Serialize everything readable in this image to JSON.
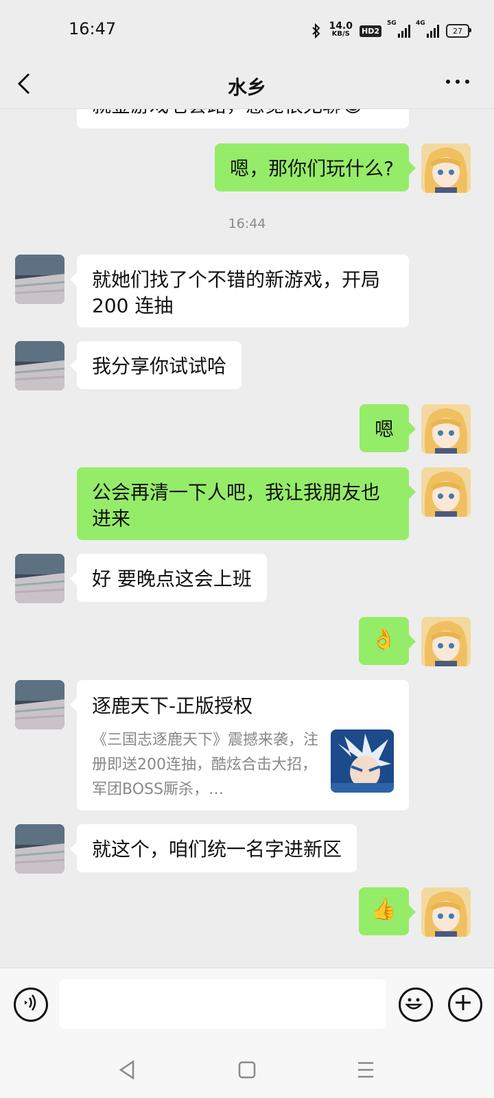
{
  "status_bar": {
    "time": "16:47",
    "net_speed_value": "14.0",
    "net_speed_unit": "KB/S",
    "hd_badge": "HD2",
    "signal1_label": "5G",
    "signal2_label": "4G",
    "battery": "27"
  },
  "nav": {
    "title": "水乡",
    "back_icon": "chevron-left-icon",
    "more_icon": "more-dots-icon"
  },
  "messages": [
    {
      "side": "in",
      "text": "就金游戏老套路，感觉很无聊😂"
    },
    {
      "side": "out",
      "text": "嗯，那你们玩什么?"
    },
    {
      "side": "time",
      "text": "16:44"
    },
    {
      "side": "in",
      "text": "就她们找了个不错的新游戏，开局200 连抽"
    },
    {
      "side": "in",
      "text": "我分享你试试哈"
    },
    {
      "side": "out",
      "text": "嗯"
    },
    {
      "side": "out",
      "text": "公会再清一下人吧，我让我朋友也进来"
    },
    {
      "side": "in",
      "text": "好 要晚点这会上班"
    },
    {
      "side": "out",
      "text": "👌"
    },
    {
      "side": "in",
      "type": "card",
      "title": "逐鹿天下-正版授权",
      "desc": "《三国志逐鹿天下》震撼来袭，注册即送200连抽，酷炫合击大招，军团BOSS厮杀，…"
    },
    {
      "side": "in",
      "text": "就这个，咱们统一名字进新区"
    },
    {
      "side": "out",
      "text": "👍"
    }
  ],
  "input": {
    "placeholder": "",
    "voice_icon": "voice-icon",
    "emoji_icon": "emoji-icon",
    "plus_icon": "plus-icon"
  },
  "system_nav": {
    "back": "back-triangle-icon",
    "home": "home-square-icon",
    "menu": "menu-lines-icon"
  },
  "colors": {
    "background": "#ededed",
    "outgoing_bubble": "#95ec69",
    "incoming_bubble": "#ffffff"
  }
}
